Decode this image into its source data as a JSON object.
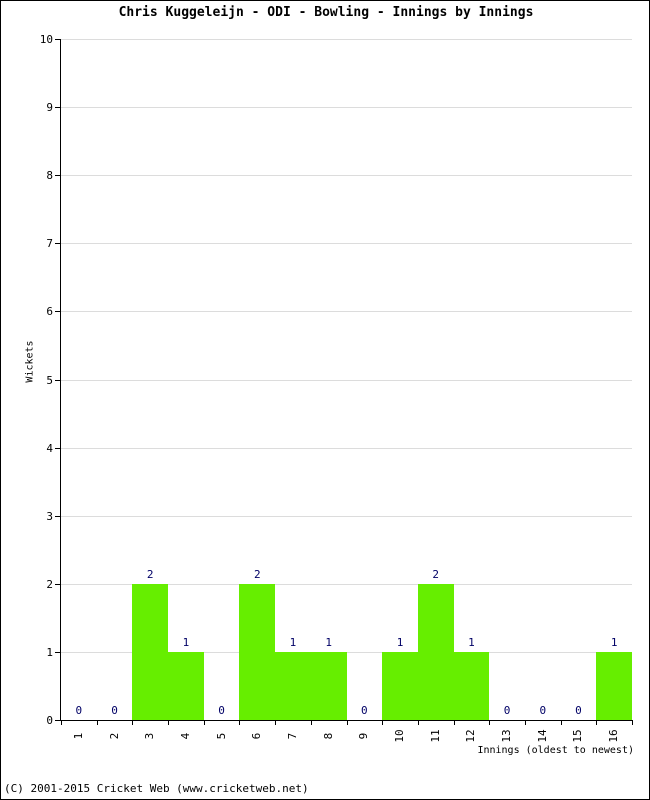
{
  "chart_data": {
    "type": "bar",
    "title": "Chris Kuggeleijn - ODI - Bowling - Innings by Innings",
    "xlabel": "Innings (oldest to newest)",
    "ylabel": "Wickets",
    "categories": [
      "1",
      "2",
      "3",
      "4",
      "5",
      "6",
      "7",
      "8",
      "9",
      "10",
      "11",
      "12",
      "13",
      "14",
      "15",
      "16"
    ],
    "values": [
      0,
      0,
      2,
      1,
      0,
      2,
      1,
      1,
      0,
      1,
      2,
      1,
      0,
      0,
      0,
      1
    ],
    "value_labels": [
      "0",
      "0",
      "2",
      "1",
      "0",
      "2",
      "1",
      "1",
      "0",
      "1",
      "2",
      "1",
      "0",
      "0",
      "0",
      "1"
    ],
    "ylim": [
      0,
      10
    ],
    "y_ticks": [
      "0",
      "1",
      "2",
      "3",
      "4",
      "5",
      "6",
      "7",
      "8",
      "9",
      "10"
    ],
    "grid": true,
    "legend": null,
    "bar_color": "#66ee00",
    "label_color": "#000066",
    "gridline_color": "#dcdcdc",
    "axis_color": "#000000"
  },
  "footer": {
    "copyright": "(C) 2001-2015 Cricket Web (www.cricketweb.net)"
  }
}
